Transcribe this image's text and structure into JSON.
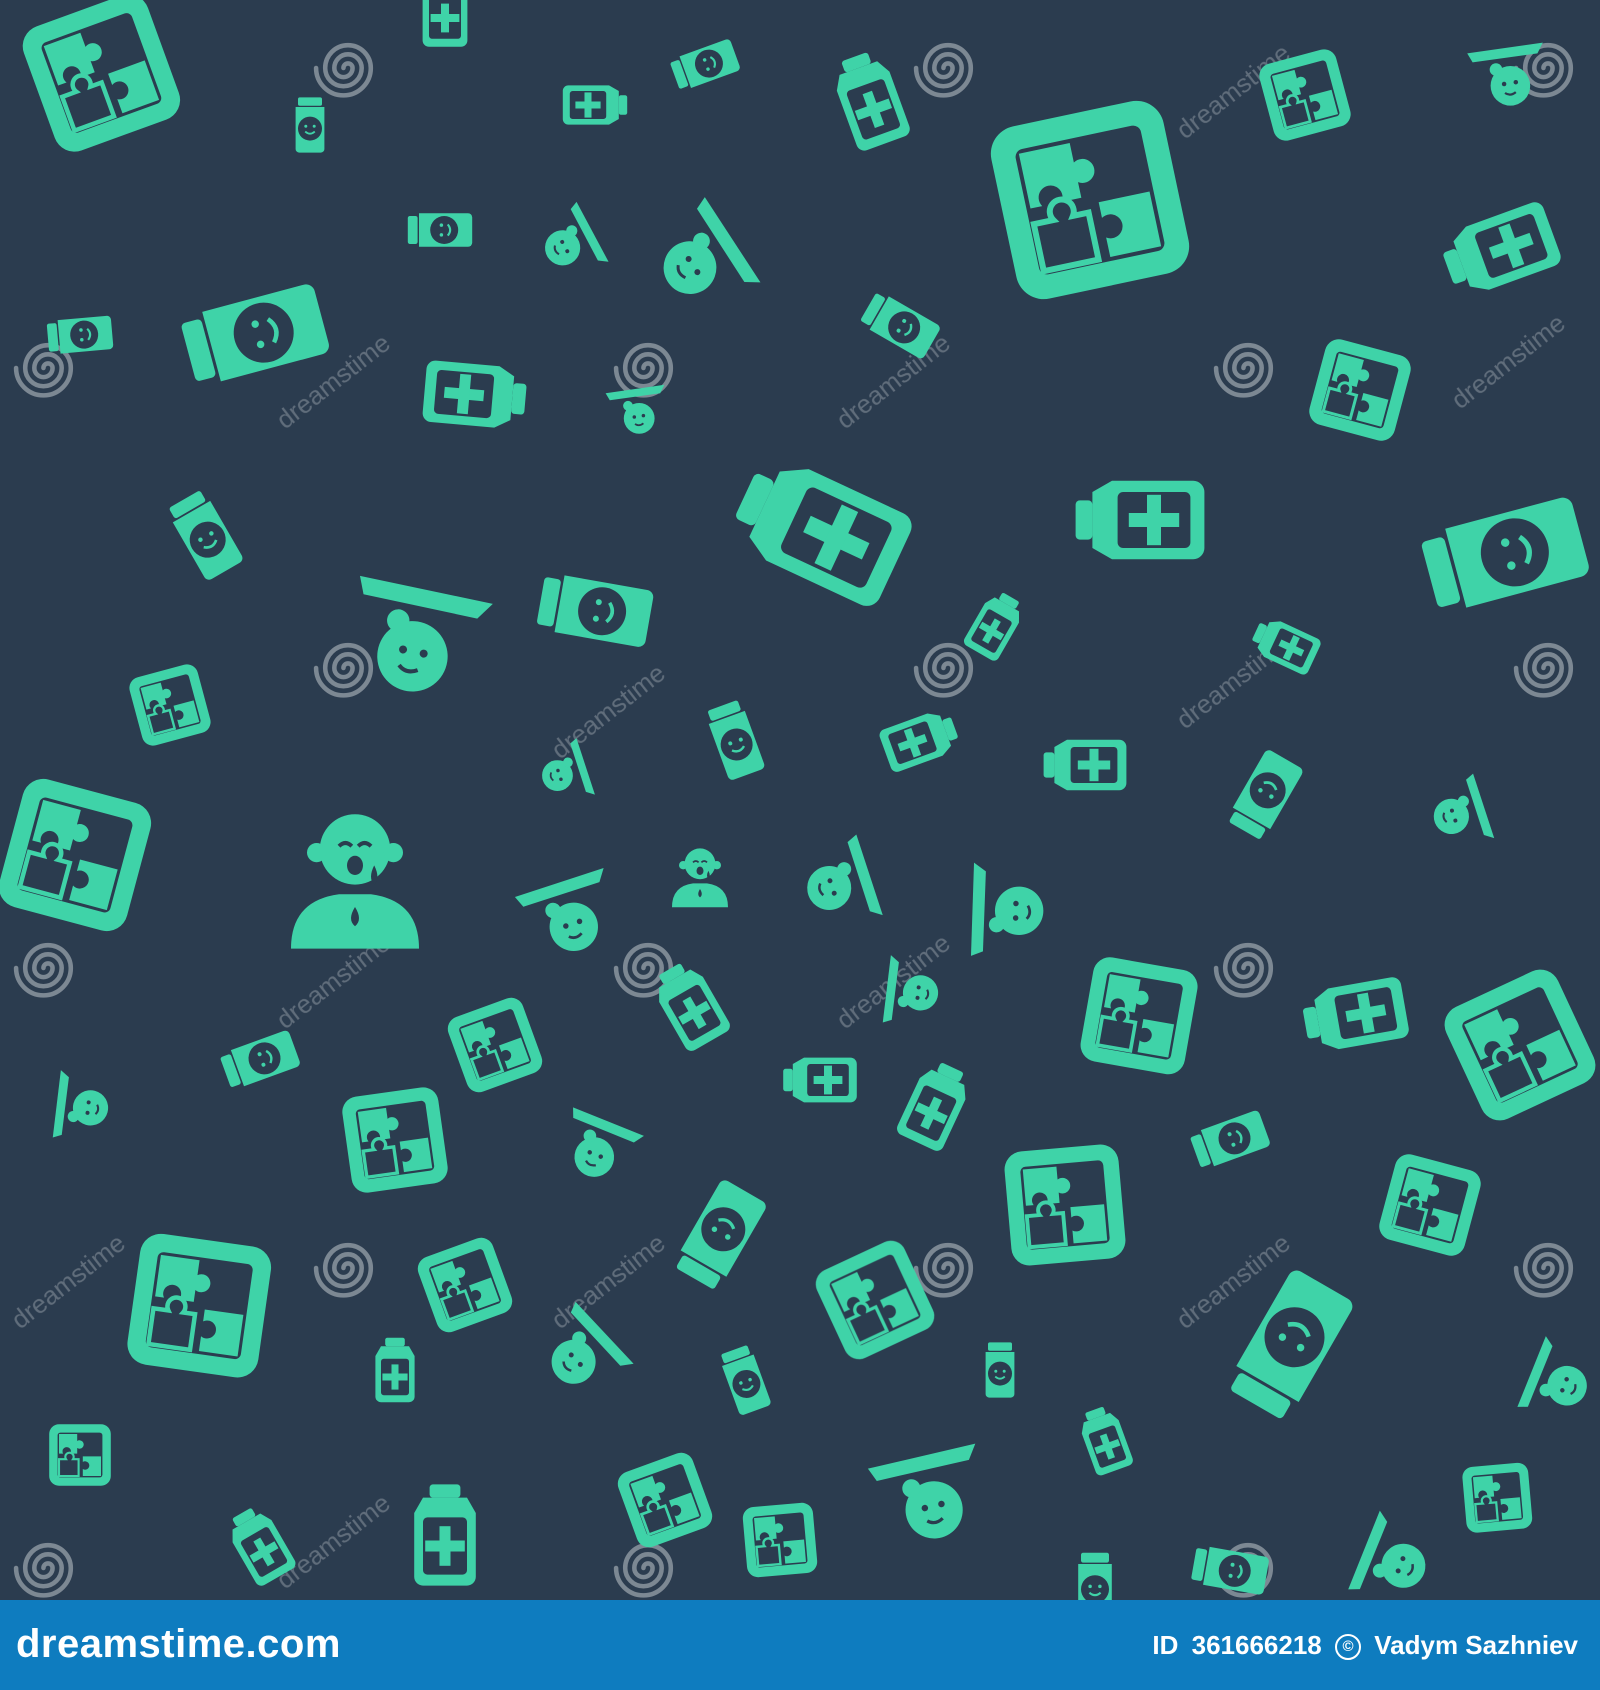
{
  "colors": {
    "background": "#2b3c4f",
    "icon": "#3fd3a8",
    "watermark": "#8c96a0",
    "footer": "#0e7cbf"
  },
  "pattern": {
    "icons": [
      "jigsaw-puzzle-icon",
      "medicine-bottle-cross-icon",
      "baby-food-jar-smile-icon",
      "baby-swing-icon",
      "crying-baby-icon",
      "spiral-watermark-icon"
    ],
    "watermark_text": "dreamstime"
  },
  "footer": {
    "brand": "dreamstime.com",
    "id_label": "ID",
    "id_value": "361666218",
    "copyright_symbol": "©",
    "author": "Vadym Sazhniev"
  }
}
